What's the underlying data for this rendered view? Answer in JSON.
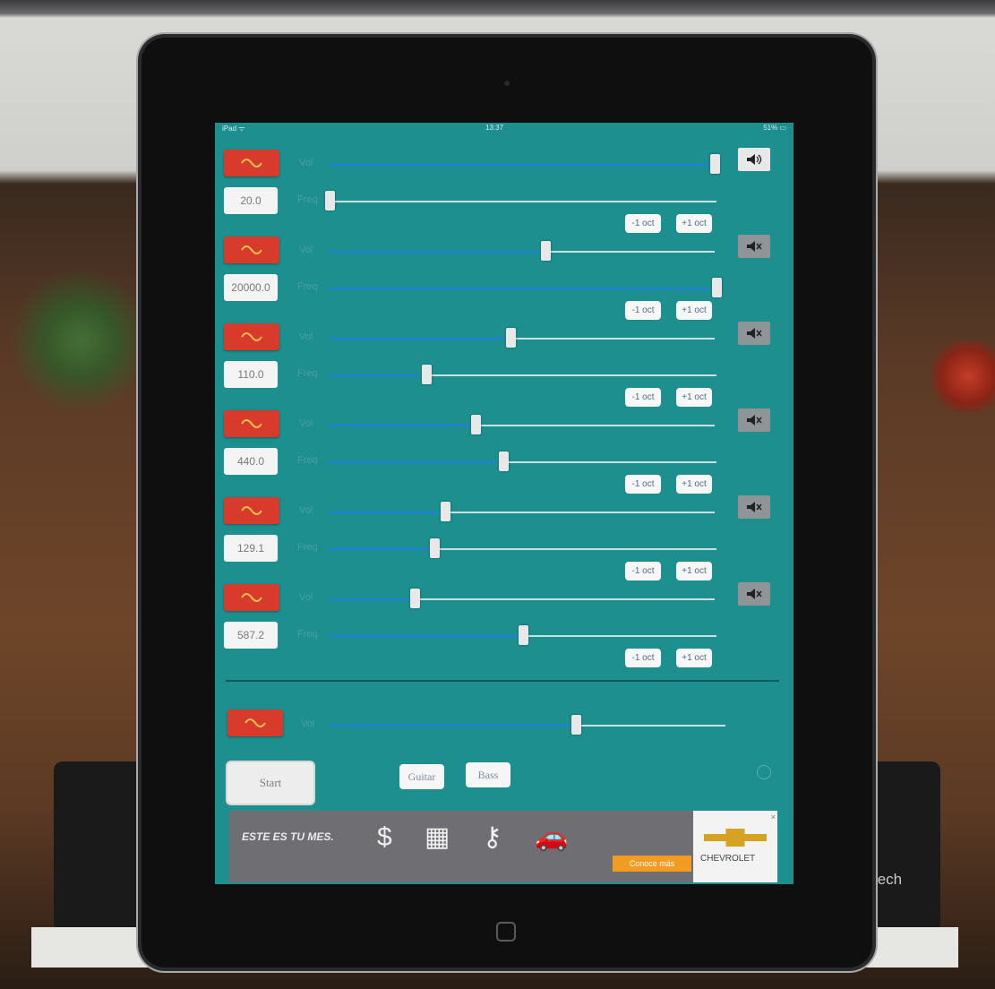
{
  "status_bar": {
    "carrier": "iPad ᯤ",
    "time": "13:37",
    "battery": "51% ▭"
  },
  "labels": {
    "vol": "Vol",
    "freq": "Freq"
  },
  "oct_down": "-1 oct",
  "oct_up": "+1 oct",
  "oscillators": [
    {
      "freq": "20.0",
      "vol": 1.0,
      "freq_pos": 0.0,
      "muted": false
    },
    {
      "freq": "20000.0",
      "vol": 0.56,
      "freq_pos": 1.0,
      "muted": true
    },
    {
      "freq": "110.0",
      "vol": 0.47,
      "freq_pos": 0.25,
      "muted": true
    },
    {
      "freq": "440.0",
      "vol": 0.38,
      "freq_pos": 0.45,
      "muted": true
    },
    {
      "freq": "129.1",
      "vol": 0.3,
      "freq_pos": 0.27,
      "muted": true
    },
    {
      "freq": "587.2",
      "vol": 0.22,
      "freq_pos": 0.5,
      "muted": true
    }
  ],
  "master": {
    "vol": 0.62
  },
  "buttons": {
    "start": "Start",
    "guitar": "Guitar",
    "bass": "Bass"
  },
  "ad": {
    "headline": "ESTE ES TU MES.",
    "icons": "$ ▦ ⚷ 🚗",
    "cta": "Conoce más",
    "brand": "CHEVROLET",
    "close": "×"
  },
  "colors": {
    "screen": "#1c8f8e",
    "wave_button": "#d83a2c",
    "slider_fill": "#1d7fe0",
    "ad_cta": "#f29b22"
  },
  "icons": {
    "wave": "sine-wave-icon",
    "speaker_on": "speaker-on-icon",
    "speaker_muted": "speaker-muted-icon",
    "info": "info-icon"
  },
  "background_brand_text": "tech"
}
